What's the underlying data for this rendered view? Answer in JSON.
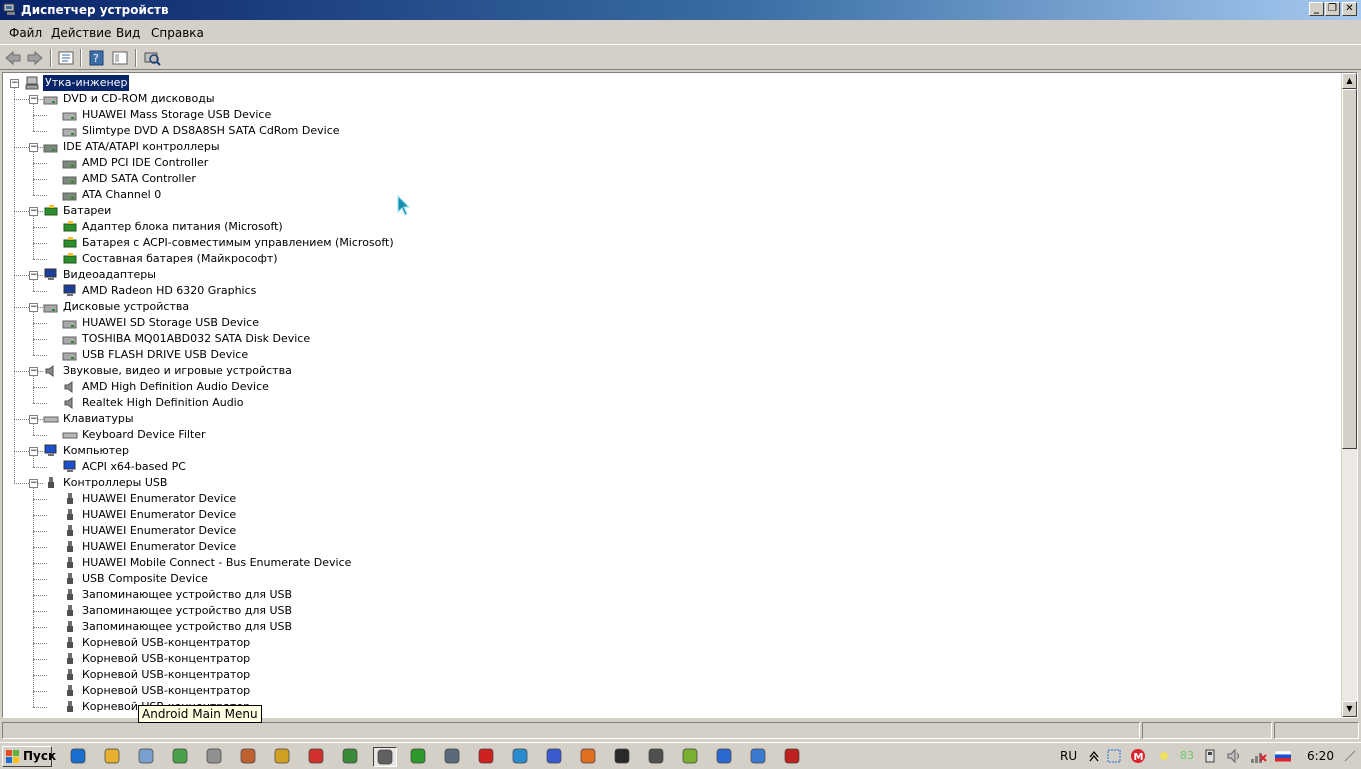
{
  "window": {
    "title": "Диспетчер устройств",
    "buttons": [
      "minimize",
      "restore",
      "close"
    ]
  },
  "menu": [
    "Файл",
    "Действие",
    "Вид",
    "Справка"
  ],
  "toolbar": [
    "back-icon",
    "forward-icon",
    "properties-icon",
    "help-icon",
    "view-icon",
    "scan-hardware-icon"
  ],
  "tree": {
    "root": "Утка-инженер",
    "categories": [
      {
        "label": "DVD и CD-ROM дисководы",
        "icon": "dvd-drive-icon",
        "items": [
          "HUAWEI Mass Storage USB Device",
          "Slimtype DVD A  DS8A8SH SATA CdRom Device"
        ]
      },
      {
        "label": "IDE ATA/ATAPI контроллеры",
        "icon": "ide-controller-icon",
        "items": [
          "AMD PCI IDE Controller",
          "AMD SATA Controller",
          "ATA Channel 0"
        ]
      },
      {
        "label": "Батареи",
        "icon": "battery-icon",
        "items": [
          "Адаптер блока питания (Microsoft)",
          "Батарея с ACPI-совместимым управлением (Microsoft)",
          "Составная батарея (Майкрософт)"
        ]
      },
      {
        "label": "Видеоадаптеры",
        "icon": "display-adapter-icon",
        "items": [
          "AMD Radeon HD 6320 Graphics"
        ]
      },
      {
        "label": "Дисковые устройства",
        "icon": "disk-drive-icon",
        "items": [
          "HUAWEI SD Storage USB Device",
          "TOSHIBA MQ01ABD032 SATA Disk Device",
          "USB FLASH DRIVE USB Device"
        ]
      },
      {
        "label": "Звуковые, видео и игровые устройства",
        "icon": "speaker-icon",
        "items": [
          "AMD High Definition Audio Device",
          "Realtek High Definition Audio"
        ]
      },
      {
        "label": "Клавиатуры",
        "icon": "keyboard-icon",
        "items": [
          "Keyboard Device Filter"
        ]
      },
      {
        "label": "Компьютер",
        "icon": "computer-icon",
        "items": [
          "ACPI x64-based PC"
        ]
      },
      {
        "label": "Контроллеры USB",
        "icon": "usb-icon",
        "items": [
          "HUAWEI Enumerator Device",
          "HUAWEI Enumerator Device",
          "HUAWEI Enumerator Device",
          "HUAWEI Enumerator Device",
          "HUAWEI Mobile Connect - Bus Enumerate Device",
          "USB Composite Device",
          "Запоминающее устройство для USB",
          "Запоминающее устройство для USB",
          "Запоминающее устройство для USB",
          "Корневой USB-концентратор",
          "Корневой USB-концентратор",
          "Корневой USB-концентратор",
          "Корневой USB-концентратор",
          "Корневой USB-концентратор"
        ]
      }
    ]
  },
  "tooltip": "Android Main Menu",
  "taskbar": {
    "start_label": "Пуск",
    "apps": [
      "ie-icon",
      "explorer-icon",
      "notepad-icon",
      "notepad-plus-icon",
      "settings-icon",
      "paint-icon",
      "archive-icon",
      "chart-icon",
      "network-icon",
      "device-manager-icon",
      "utorrent-icon",
      "tools-icon",
      "opera-icon",
      "folder-sync-icon",
      "globe-icon",
      "avast-icon",
      "terminal-icon",
      "calculator-icon",
      "android-icon",
      "browser-icon",
      "chat-icon",
      "toolbox-icon"
    ],
    "lang": "RU",
    "tray_number": "83",
    "clock": "6:20"
  },
  "colors": {
    "title_start": "#0a246a",
    "title_end": "#a6caf0",
    "selection": "#0a246a",
    "tooltip_bg": "#ffffe1"
  }
}
